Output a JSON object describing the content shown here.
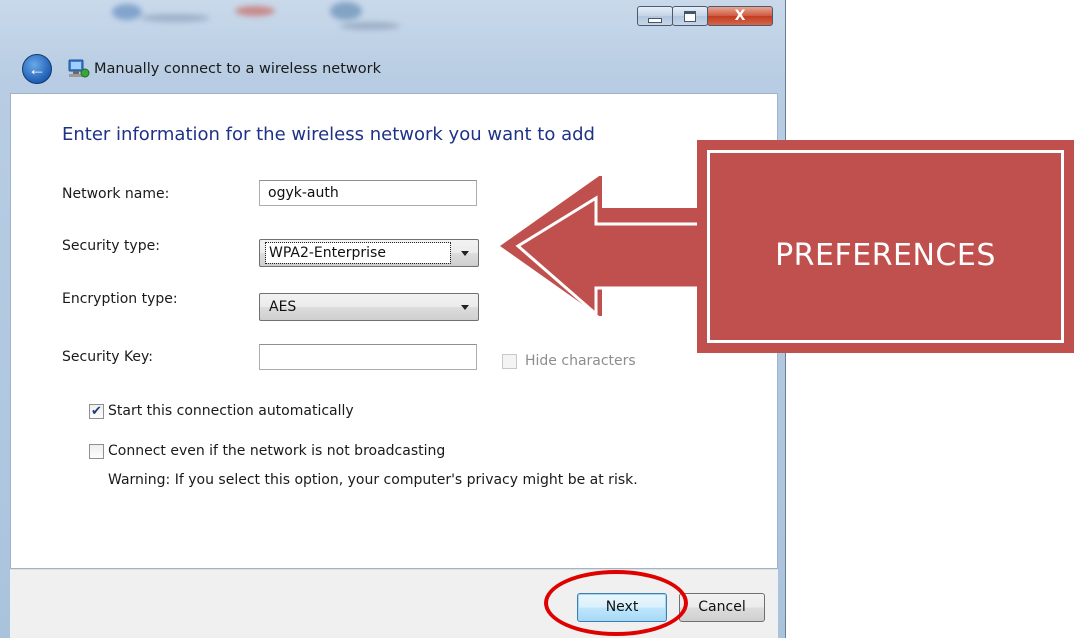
{
  "window": {
    "title": "Manually connect to a wireless network",
    "controls": {
      "close_glyph": "X"
    }
  },
  "nav": {
    "back_glyph": "←"
  },
  "heading": "Enter information for the wireless network you want to add",
  "form": {
    "network_name": {
      "label": "Network name:",
      "value": "ogyk-auth"
    },
    "security_type": {
      "label": "Security type:",
      "value": "WPA2-Enterprise"
    },
    "encryption_type": {
      "label": "Encryption type:",
      "value": "AES"
    },
    "security_key": {
      "label": "Security Key:",
      "value": "",
      "hide_characters_label": "Hide characters",
      "hide_characters_checked": false,
      "hide_characters_enabled": false
    }
  },
  "options": {
    "start_automatically": {
      "label": "Start this connection automatically",
      "checked": true
    },
    "connect_not_broadcasting": {
      "label": "Connect even if the network is not broadcasting",
      "checked": false
    },
    "warning": "Warning: If you select this option, your computer's privacy might be at risk."
  },
  "footer": {
    "next_label": "Next",
    "cancel_label": "Cancel"
  },
  "annotation": {
    "callout_text": "PREFERENCES",
    "callout_color": "#c0504d",
    "highlight_color": "#e00000"
  },
  "icons": {
    "check_glyph": "✔"
  }
}
